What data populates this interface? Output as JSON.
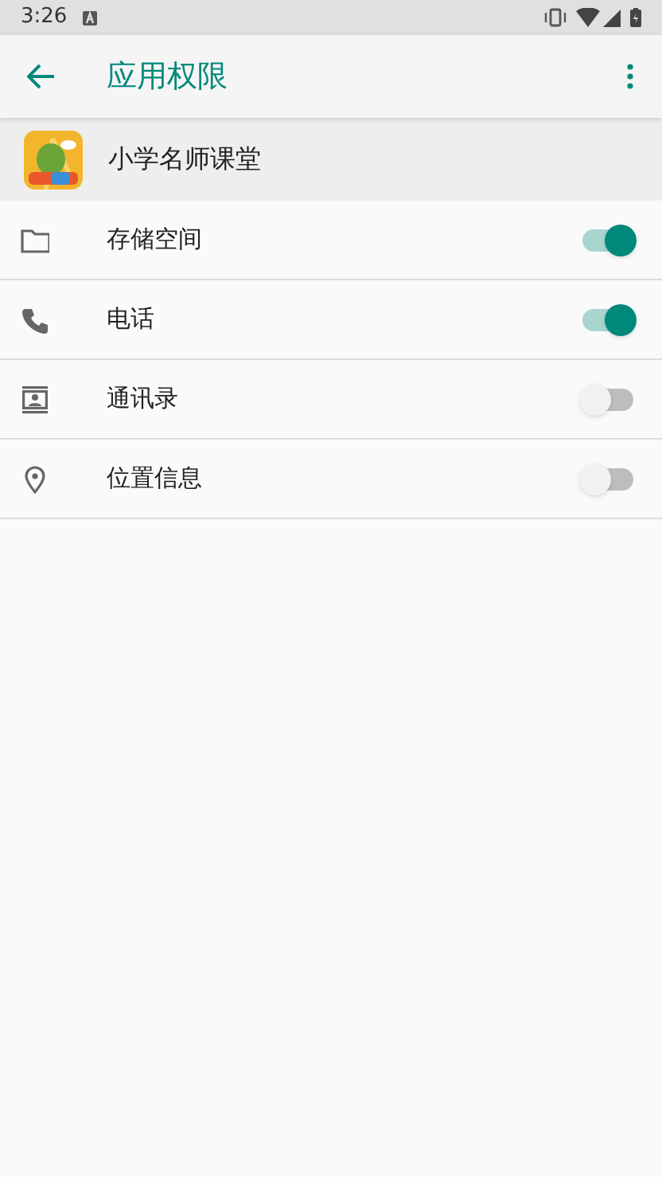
{
  "status_bar": {
    "time": "3:26"
  },
  "toolbar": {
    "title": "应用权限"
  },
  "app": {
    "name": "小学名师课堂"
  },
  "permissions": [
    {
      "kind": "storage",
      "label": "存储空间",
      "on": true
    },
    {
      "kind": "phone",
      "label": "电话",
      "on": true
    },
    {
      "kind": "contacts",
      "label": "通讯录",
      "on": false
    },
    {
      "kind": "location",
      "label": "位置信息",
      "on": false
    }
  ]
}
